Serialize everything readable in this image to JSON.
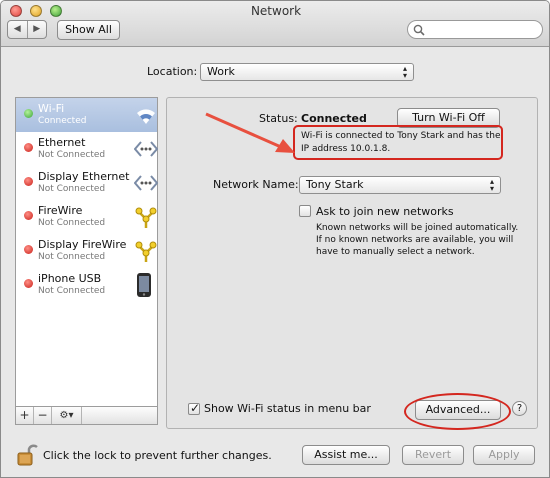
{
  "window": {
    "title": "Network"
  },
  "toolbar": {
    "show_all_label": "Show All",
    "search_placeholder": ""
  },
  "location": {
    "label": "Location:",
    "value": "Work"
  },
  "services": [
    {
      "name": "Wi-Fi",
      "status": "Connected",
      "indicator": "green",
      "icon": "wifi-icon",
      "selected": true
    },
    {
      "name": "Ethernet",
      "status": "Not Connected",
      "indicator": "red",
      "icon": "ethernet-icon"
    },
    {
      "name": "Display Ethernet",
      "status": "Not Connected",
      "indicator": "red",
      "icon": "ethernet-icon"
    },
    {
      "name": "FireWire",
      "status": "Not Connected",
      "indicator": "red",
      "icon": "firewire-icon"
    },
    {
      "name": "Display FireWire",
      "status": "Not Connected",
      "indicator": "red",
      "icon": "firewire-icon"
    },
    {
      "name": "iPhone USB",
      "status": "Not Connected",
      "indicator": "red",
      "icon": "iphone-icon"
    }
  ],
  "sidebar_controls": {
    "add": "+",
    "remove": "−",
    "gear": "⚙▾"
  },
  "detail": {
    "status_label": "Status:",
    "status_value": "Connected",
    "turn_off_label": "Turn Wi-Fi Off",
    "status_note_line1": "Wi-Fi is connected to Tony Stark and has the",
    "status_note_line2": "IP address 10.0.1.8.",
    "network_name_label": "Network Name:",
    "network_name_value": "Tony Stark",
    "ask_join_label": "Ask to join new networks",
    "ask_join_checked": false,
    "ask_join_note_line1": "Known networks will be joined automatically.",
    "ask_join_note_line2": "If no known networks are available, you will",
    "ask_join_note_line3": "have to manually select a network.",
    "show_status_label": "Show Wi-Fi status in menu bar",
    "show_status_checked": true,
    "advanced_label": "Advanced...",
    "help_label": "?"
  },
  "footer": {
    "lock_text": "Click the lock to prevent further changes.",
    "assist_label": "Assist me...",
    "revert_label": "Revert",
    "apply_label": "Apply"
  },
  "colors": {
    "annotation": "#d4271f",
    "selection": "#b3c6e3",
    "connected": "#3aa33a",
    "disconnected": "#c92019"
  }
}
